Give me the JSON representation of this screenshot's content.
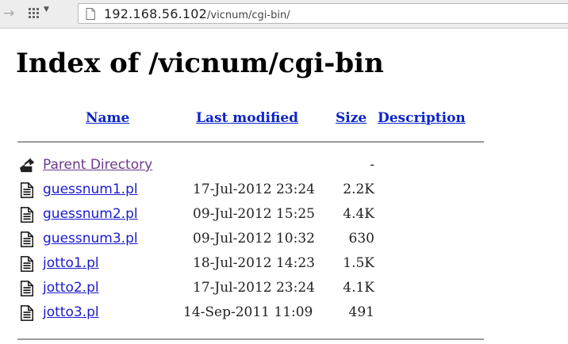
{
  "browser": {
    "url_host": "192.168.56.102",
    "url_path": "/vicnum/cgi-bin/",
    "icons": {
      "forward": "forward-arrow-icon",
      "apps": "apps-grid-icon",
      "page": "page-icon"
    }
  },
  "page": {
    "title": "Index of /vicnum/cgi-bin",
    "columns": {
      "name": "Name",
      "last_modified": "Last modified",
      "size": "Size",
      "description": "Description"
    },
    "parent": {
      "label": "Parent Directory",
      "size": "-",
      "icon": "back-folder-icon"
    },
    "files": [
      {
        "name": "guessnum1.pl",
        "date": "17-Jul-2012 23:24",
        "size": "2.2K",
        "icon": "text-file-icon",
        "visited": false
      },
      {
        "name": "guessnum2.pl",
        "date": "09-Jul-2012 15:25",
        "size": "4.4K",
        "icon": "text-file-icon",
        "visited": false
      },
      {
        "name": "guessnum3.pl",
        "date": "09-Jul-2012 10:32",
        "size": "630",
        "icon": "text-file-icon",
        "visited": false
      },
      {
        "name": "jotto1.pl",
        "date": "18-Jul-2012 14:23",
        "size": "1.5K",
        "icon": "text-file-icon",
        "visited": false
      },
      {
        "name": "jotto2.pl",
        "date": "17-Jul-2012 23:24",
        "size": "4.1K",
        "icon": "text-file-icon",
        "visited": false
      },
      {
        "name": "jotto3.pl",
        "date": "14-Sep-2011 11:09",
        "size": "491",
        "icon": "text-file-icon",
        "visited": false
      }
    ]
  },
  "colors": {
    "link": "#1a1ad0",
    "visited": "#6b3a8a",
    "header_link": "#0b24c8",
    "rule": "#9a9a9a"
  }
}
